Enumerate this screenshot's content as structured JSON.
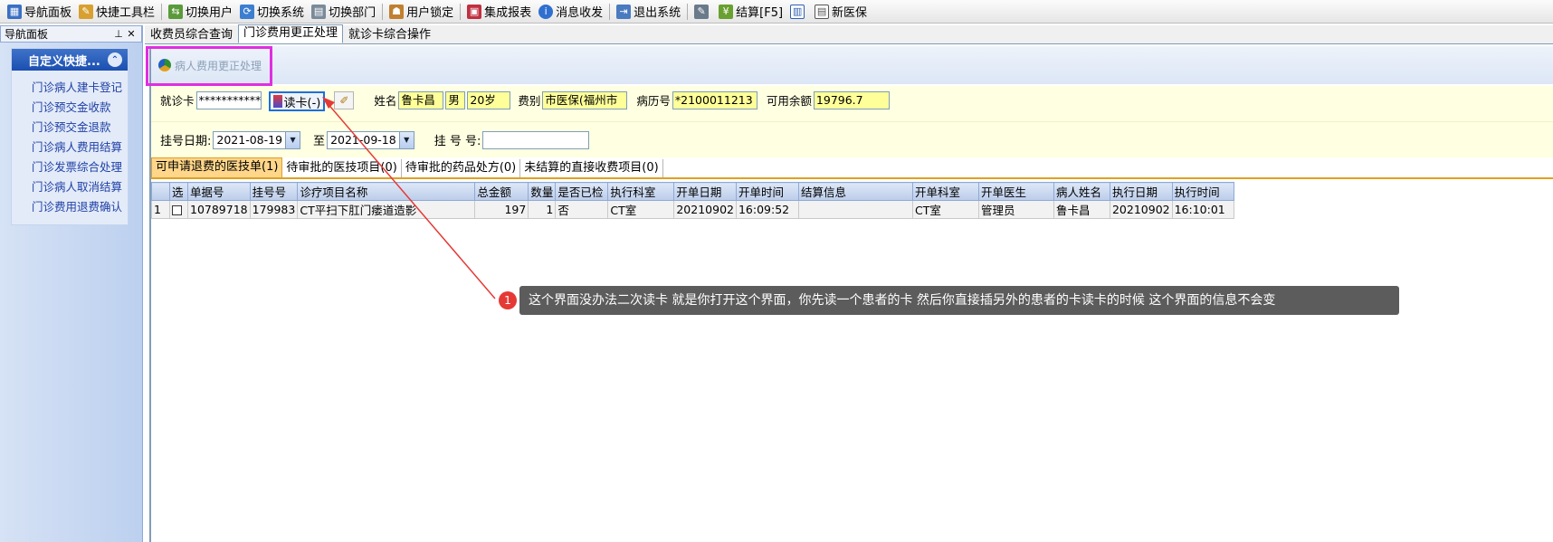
{
  "toolbar": {
    "items": [
      {
        "label": "导航面板",
        "icon": "nav-panel-icon"
      },
      {
        "label": "快捷工具栏",
        "icon": "shortcut-toolbar-icon"
      },
      {
        "label": "切换用户",
        "icon": "switch-user-icon"
      },
      {
        "label": "切换系统",
        "icon": "switch-system-icon"
      },
      {
        "label": "切换部门",
        "icon": "switch-department-icon"
      },
      {
        "label": "用户锁定",
        "icon": "user-lock-icon"
      },
      {
        "label": "集成报表",
        "icon": "report-icon"
      },
      {
        "label": "消息收发",
        "icon": "message-icon"
      },
      {
        "label": "退出系统",
        "icon": "exit-icon"
      },
      {
        "label": "结算[F5]",
        "icon": "settle-icon"
      },
      {
        "label": "新医保",
        "icon": "new-insurance-icon"
      }
    ]
  },
  "nav": {
    "header": "导航面板",
    "group_title": "自定义快捷...",
    "links": [
      "门诊病人建卡登记",
      "门诊预交金收款",
      "门诊预交金退款",
      "门诊病人费用结算",
      "门诊发票综合处理",
      "门诊病人取消结算",
      "门诊费用退费确认"
    ]
  },
  "tabs": [
    "收费员综合查询",
    "门诊费用更正处理",
    "就诊卡综合操作"
  ],
  "active_tab": 1,
  "panel_title": "病人费用更正处理",
  "patient": {
    "card_label": "就诊卡",
    "card_value": "***********",
    "read_card_label": "读卡(-)",
    "name_label": "姓名",
    "name": "鲁卡昌",
    "sex": "男",
    "age": "20岁",
    "fee_type_label": "费别",
    "fee_type": "市医保(福州市",
    "record_no_label": "病历号",
    "record_no": "*2100011213",
    "balance_label": "可用余额",
    "balance": "19796.7"
  },
  "filter": {
    "reg_date_label": "挂号日期:",
    "date_from": "2021-08-19",
    "to_label": "至",
    "date_to": "2021-09-18",
    "reg_no_label": "挂 号 号:",
    "reg_no": ""
  },
  "sub_tabs": [
    "可申请退费的医技单(1)",
    "待审批的医技项目(0)",
    "待审批的药品处方(0)",
    "未结算的直接收费项目(0)"
  ],
  "grid": {
    "columns": [
      "",
      "选",
      "单据号",
      "挂号号",
      "诊疗项目名称",
      "总金额",
      "数量",
      "是否已检",
      "执行科室",
      "开单日期",
      "开单时间",
      "结算信息",
      "开单科室",
      "开单医生",
      "病人姓名",
      "执行日期",
      "执行时间"
    ],
    "rows": [
      [
        "1",
        "",
        "10789718",
        "179983",
        "CT平扫下肛门瘘道造影",
        "197",
        "1",
        "否",
        "CT室",
        "20210902",
        "16:09:52",
        "",
        "CT室",
        "管理员",
        "鲁卡昌",
        "20210902",
        "16:10:01"
      ]
    ]
  },
  "annotation": {
    "number": "1",
    "text": "这个界面没办法二次读卡 就是你打开这个界面，你先读一个患者的卡 然后你直接插另外的患者的卡读卡的时候 这个界面的信息不会变"
  },
  "colors": {
    "nav_title": "#1b4fb1",
    "highlight_magenta": "#e02ee0",
    "highlight_blue": "#1e6fd9",
    "arrow_red": "#e53935",
    "form_bg": "#ffffe1",
    "value_yellow": "#ffff99"
  }
}
